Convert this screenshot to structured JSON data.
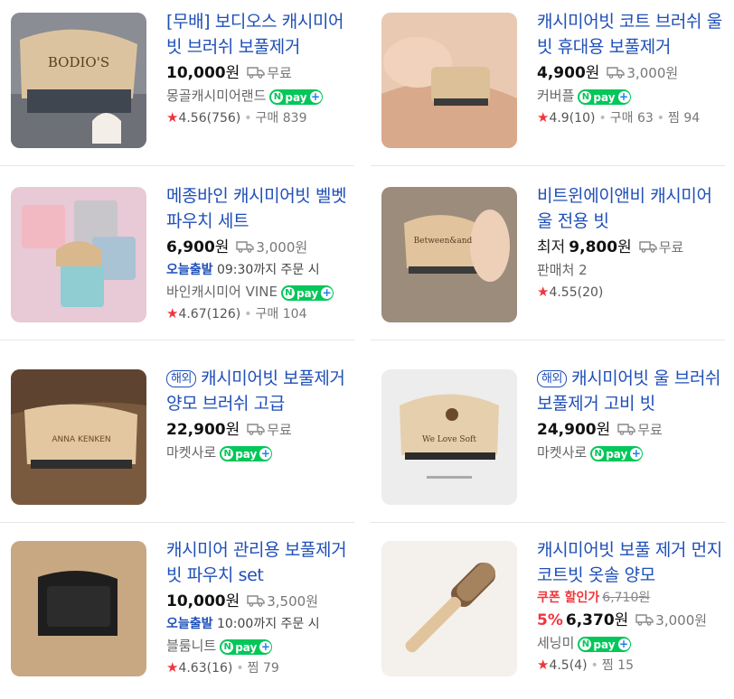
{
  "products": [
    {
      "title": "[무배] 보디오스 캐시미어 빗 브러쉬 보풀제거",
      "overseas": "",
      "price_prefix": "",
      "coupon": "",
      "discount": "",
      "original_price": "",
      "price": "10,000",
      "won": "원",
      "shipping": "무료",
      "delivery_highlight": "",
      "delivery_text": "",
      "seller": "몽골캐시미어랜드",
      "npay": "pay",
      "rating": "4.56",
      "review_count": "(756)",
      "extra": [
        {
          "label": "구매 839"
        }
      ],
      "thumb_text": "BODIO'S"
    },
    {
      "title": "캐시미어빗 코트 브러쉬 울빗 휴대용 보풀제거",
      "overseas": "",
      "price_prefix": "",
      "coupon": "",
      "discount": "",
      "original_price": "",
      "price": "4,900",
      "won": "원",
      "shipping": "3,000원",
      "delivery_highlight": "",
      "delivery_text": "",
      "seller": "커버플",
      "npay": "pay",
      "rating": "4.9",
      "review_count": "(10)",
      "extra": [
        {
          "label": "구매 63"
        },
        {
          "label": "찜 94"
        }
      ],
      "thumb_text": ""
    },
    {
      "title": "메종바인 캐시미어빗 벨벳 파우치 세트",
      "overseas": "",
      "price_prefix": "",
      "coupon": "",
      "discount": "",
      "original_price": "",
      "price": "6,900",
      "won": "원",
      "shipping": "3,000원",
      "delivery_highlight": "오늘출발",
      "delivery_text": "09:30까지 주문 시",
      "seller": "바인캐시미어 VINE",
      "npay": "pay",
      "rating": "4.67",
      "review_count": "(126)",
      "extra": [
        {
          "label": "구매 104"
        }
      ],
      "thumb_text": ""
    },
    {
      "title": "비트윈에이앤비 캐시미어 울 전용 빗",
      "overseas": "",
      "price_prefix": "최저",
      "coupon": "",
      "discount": "",
      "original_price": "",
      "price": "9,800",
      "won": "원",
      "shipping": "무료",
      "delivery_highlight": "",
      "delivery_text": "",
      "seller": "판매처 2",
      "npay": "",
      "rating": "4.55",
      "review_count": "(20)",
      "extra": [],
      "thumb_text": "Between&and"
    },
    {
      "title": "캐시미어빗 보풀제거 양모 브러쉬 고급",
      "overseas": "해외",
      "price_prefix": "",
      "coupon": "",
      "discount": "",
      "original_price": "",
      "price": "22,900",
      "won": "원",
      "shipping": "무료",
      "delivery_highlight": "",
      "delivery_text": "",
      "seller": "마켓사로",
      "npay": "pay",
      "rating": "",
      "review_count": "",
      "extra": [],
      "thumb_text": "ANNA KENKEN"
    },
    {
      "title": "캐시미어빗 울 브러쉬 보풀제거 고비 빗",
      "overseas": "해외",
      "price_prefix": "",
      "coupon": "",
      "discount": "",
      "original_price": "",
      "price": "24,900",
      "won": "원",
      "shipping": "무료",
      "delivery_highlight": "",
      "delivery_text": "",
      "seller": "마켓사로",
      "npay": "pay",
      "rating": "",
      "review_count": "",
      "extra": [],
      "thumb_text": "We Love Soft"
    },
    {
      "title": "캐시미어 관리용 보풀제거 빗 파우치 set",
      "overseas": "",
      "price_prefix": "",
      "coupon": "",
      "discount": "",
      "original_price": "",
      "price": "10,000",
      "won": "원",
      "shipping": "3,500원",
      "delivery_highlight": "오늘출발",
      "delivery_text": "10:00까지 주문 시",
      "seller": "블룸니트",
      "npay": "pay",
      "rating": "4.63",
      "review_count": "(16)",
      "extra": [
        {
          "label": "찜 79"
        }
      ],
      "thumb_text": ""
    },
    {
      "title": "캐시미어빗 보풀 제거 먼지 코트빗 옷솔 양모",
      "overseas": "",
      "price_prefix": "",
      "coupon": "쿠폰 할인가",
      "discount": "5%",
      "original_price": "6,710원",
      "price": "6,370",
      "won": "원",
      "shipping": "3,000원",
      "delivery_highlight": "",
      "delivery_text": "",
      "seller": "세닝미",
      "npay": "pay",
      "rating": "4.5",
      "review_count": "(4)",
      "extra": [
        {
          "label": "찜 15"
        }
      ],
      "thumb_text": ""
    }
  ]
}
